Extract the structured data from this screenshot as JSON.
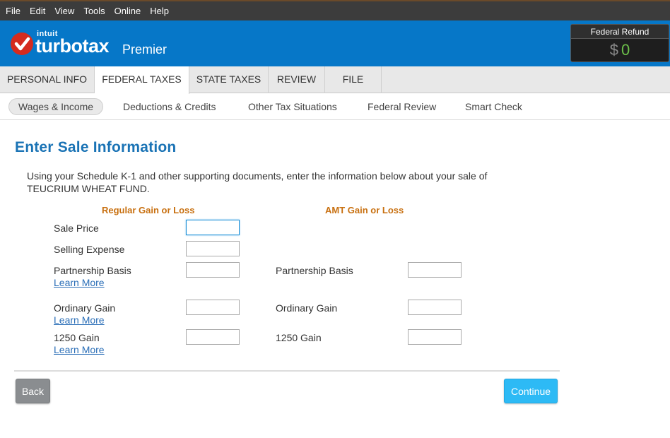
{
  "menu": [
    "File",
    "Edit",
    "View",
    "Tools",
    "Online",
    "Help"
  ],
  "brand": {
    "intuit": "intuit",
    "turbotax": "turbotax",
    "edition": "Premier",
    "check_color": "#d52b1e",
    "header_color": "#0677c8"
  },
  "refund": {
    "label": "Federal Refund",
    "currency": "$",
    "amount": "0"
  },
  "tabs": [
    {
      "label": "PERSONAL INFO"
    },
    {
      "label": "FEDERAL TAXES"
    },
    {
      "label": "STATE TAXES"
    },
    {
      "label": "REVIEW"
    },
    {
      "label": "FILE"
    }
  ],
  "subnav": [
    {
      "label": "Wages & Income"
    },
    {
      "label": "Deductions & Credits"
    },
    {
      "label": "Other Tax Situations"
    },
    {
      "label": "Federal Review"
    },
    {
      "label": "Smart Check"
    }
  ],
  "page": {
    "title": "Enter Sale Information",
    "intro": "Using your Schedule K-1 and other supporting documents, enter the information below about your sale of TEUCRIUM WHEAT FUND."
  },
  "regular": {
    "heading": "Regular Gain or Loss",
    "sale_price": {
      "label": "Sale Price",
      "value": ""
    },
    "selling_expense": {
      "label": "Selling Expense",
      "value": ""
    },
    "partnership_basis": {
      "label": "Partnership Basis",
      "value": "",
      "link": "Learn More"
    },
    "ordinary_gain": {
      "label": "Ordinary Gain",
      "value": "",
      "link": "Learn More"
    },
    "gain_1250": {
      "label": "1250 Gain",
      "value": "",
      "link": "Learn More"
    }
  },
  "amt": {
    "heading": "AMT Gain or Loss",
    "partnership_basis": {
      "label": "Partnership Basis",
      "value": ""
    },
    "ordinary_gain": {
      "label": "Ordinary Gain",
      "value": ""
    },
    "gain_1250": {
      "label": "1250 Gain",
      "value": ""
    }
  },
  "buttons": {
    "back": "Back",
    "continue": "Continue"
  }
}
